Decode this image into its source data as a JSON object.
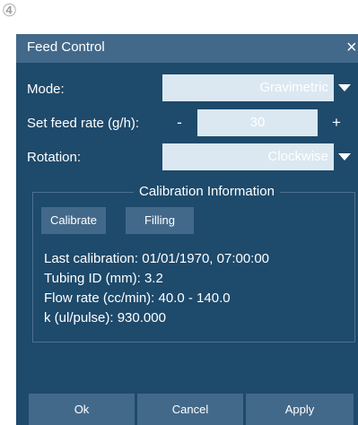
{
  "badge": "④",
  "window": {
    "title": "Feed Control",
    "close_glyph": "×"
  },
  "mode": {
    "label": "Mode:",
    "value": "Gravimetric"
  },
  "feed_rate": {
    "label": "Set feed rate (g/h):",
    "minus": "-",
    "value": "30",
    "plus": "+"
  },
  "rotation": {
    "label": "Rotation:",
    "value": "Clockwise"
  },
  "calibration": {
    "title": "Calibration Information",
    "calibrate_button": "Calibrate",
    "filling_button": "Filling",
    "lines": [
      "Last calibration: 01/01/1970, 07:00:00",
      "Tubing ID (mm): 3.2",
      "Flow rate (cc/min): 40.0 - 140.0",
      "k (ul/pulse): 930.000"
    ]
  },
  "footer": {
    "ok": "Ok",
    "cancel": "Cancel",
    "apply": "Apply"
  },
  "colors": {
    "dialog_bg": "#1e4a6b",
    "titlebar_bg": "#43698a",
    "field_bg": "#dbe8f1",
    "button_bg": "#43698a"
  }
}
